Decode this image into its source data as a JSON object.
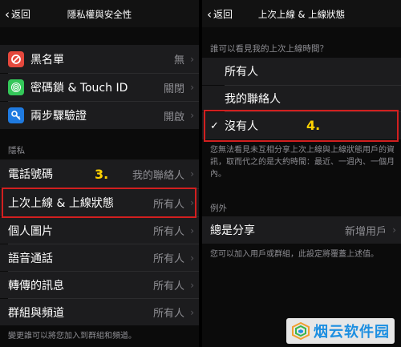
{
  "left": {
    "back": "返回",
    "title": "隱私權與安全性",
    "top_rows": [
      {
        "label": "黑名單",
        "value": "無"
      },
      {
        "label": "密碼鎖 & Touch ID",
        "value": "關閉"
      },
      {
        "label": "兩步驟驗證",
        "value": "開啟"
      }
    ],
    "section": "隱私",
    "privacy_rows": [
      {
        "label": "電話號碼",
        "value": "我的聯絡人"
      },
      {
        "label": "上次上線 & 上線狀態",
        "value": "所有人"
      },
      {
        "label": "個人圖片",
        "value": "所有人"
      },
      {
        "label": "語音通話",
        "value": "所有人"
      },
      {
        "label": "轉傳的訊息",
        "value": "所有人"
      },
      {
        "label": "群組與頻道",
        "value": "所有人"
      }
    ],
    "footer": "變更誰可以將您加入到群組和頻道。",
    "step": "3."
  },
  "right": {
    "back": "返回",
    "title": "上次上線 & 上線狀態",
    "question": "誰可以看見我的上次上線時間？",
    "options": [
      {
        "label": "所有人",
        "checked": false
      },
      {
        "label": "我的聯絡人",
        "checked": false
      },
      {
        "label": "沒有人",
        "checked": true
      }
    ],
    "note": "您無法看見未互相分享上次上線與上線狀態用戶的資訊，取而代之的是大約時間：最近、一週內、一個月內。",
    "exceptions_header": "例外",
    "always_share": {
      "label": "總是分享",
      "value": "新增用戶"
    },
    "exceptions_note": "您可以加入用戶或群組，此設定將覆蓋上述值。",
    "step": "4.",
    "check_mark": "✓"
  },
  "watermark": "烟云软件园",
  "colors": {
    "highlight": "#d21f1f",
    "step": "#ffd200",
    "blocklist": "#e5483d",
    "passcode": "#34c759",
    "twostep": "#1f7ae0"
  },
  "icons": [
    "block-icon",
    "fingerprint-icon",
    "key-icon",
    "chevron-right-icon",
    "check-icon"
  ]
}
